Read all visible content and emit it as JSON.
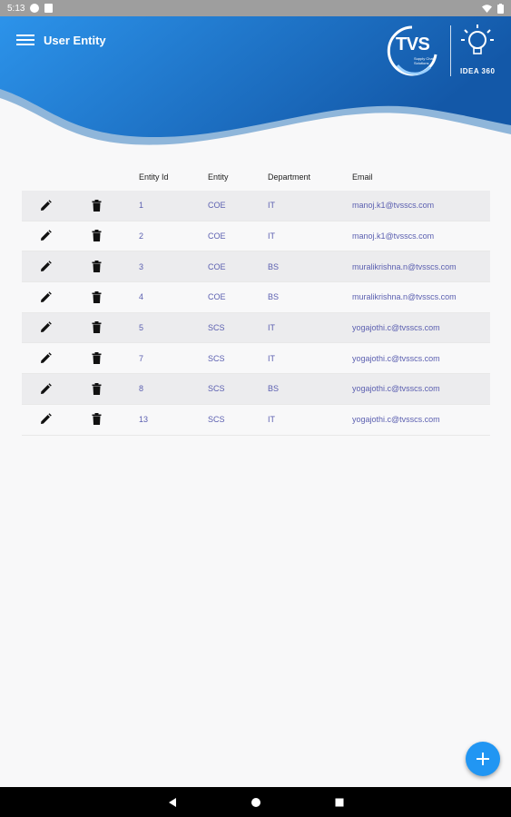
{
  "status_bar": {
    "time": "5:13"
  },
  "header": {
    "title": "User Entity",
    "logo_text": "TVS",
    "logo_sub": "Supply Chain Solutions",
    "logo_tag": "IDEA 360",
    "gradient_start": "#2a8fe6",
    "gradient_end": "#1560b0"
  },
  "table": {
    "columns": {
      "id": "Entity Id",
      "entity": "Entity",
      "department": "Department",
      "email": "Email"
    },
    "rows": [
      {
        "id": "1",
        "entity": "COE",
        "department": "IT",
        "email": "manoj.k1@tvsscs.com"
      },
      {
        "id": "2",
        "entity": "COE",
        "department": "IT",
        "email": "manoj.k1@tvsscs.com"
      },
      {
        "id": "3",
        "entity": "COE",
        "department": "BS",
        "email": "muralikrishna.n@tvsscs.com"
      },
      {
        "id": "4",
        "entity": "COE",
        "department": "BS",
        "email": "muralikrishna.n@tvsscs.com"
      },
      {
        "id": "5",
        "entity": "SCS",
        "department": "IT",
        "email": "yogajothi.c@tvsscs.com"
      },
      {
        "id": "7",
        "entity": "SCS",
        "department": "IT",
        "email": "yogajothi.c@tvsscs.com"
      },
      {
        "id": "8",
        "entity": "SCS",
        "department": "BS",
        "email": "yogajothi.c@tvsscs.com"
      },
      {
        "id": "13",
        "entity": "SCS",
        "department": "IT",
        "email": "yogajothi.c@tvsscs.com"
      }
    ]
  },
  "icons": {
    "edit": "pencil-icon",
    "delete": "trash-icon",
    "fab": "plus-icon",
    "menu": "hamburger-menu-icon"
  },
  "colors": {
    "fab": "#2196f3",
    "cell_text": "#5b5fb0",
    "row_shade": "#ececee"
  }
}
